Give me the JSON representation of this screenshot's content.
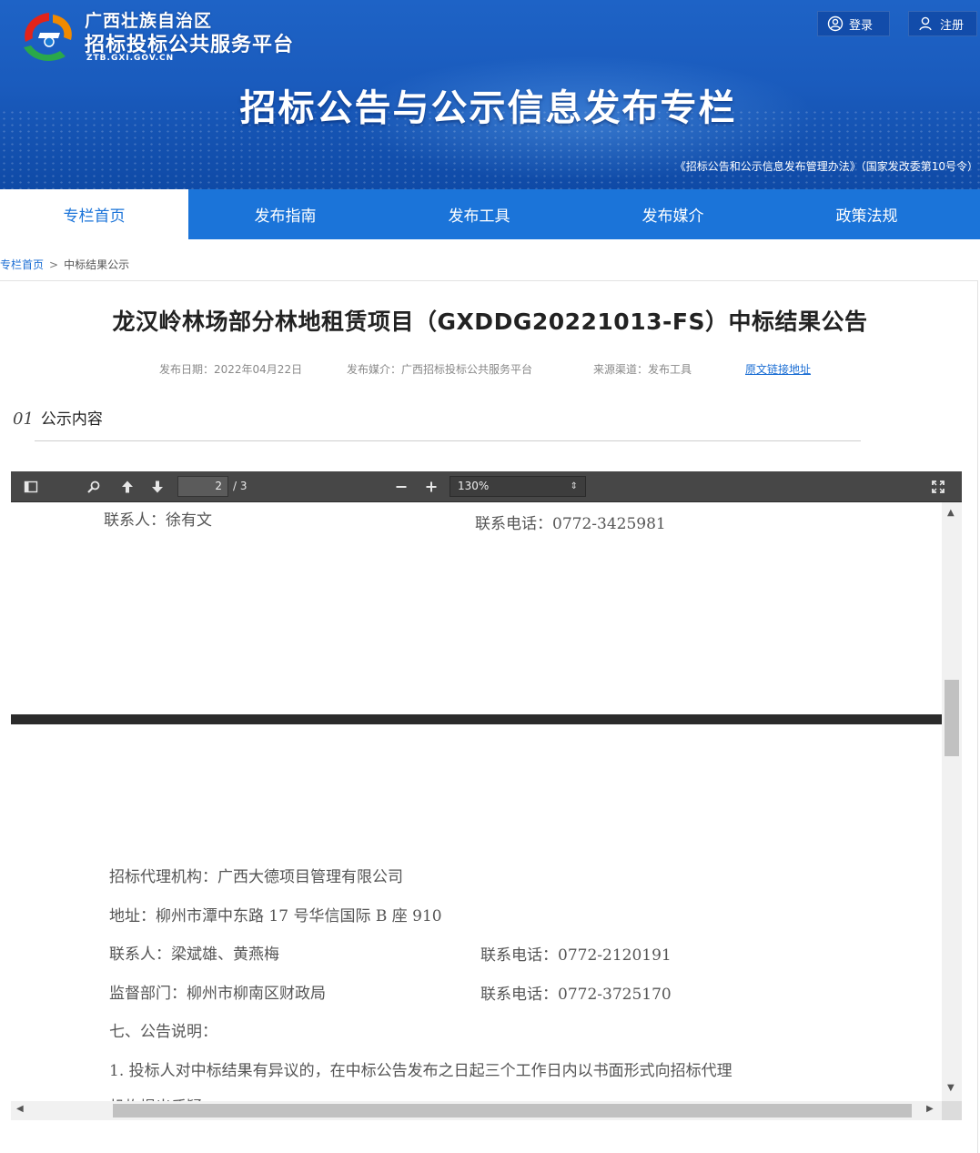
{
  "colors": {
    "brand_blue": "#1b74d9",
    "banner_blue": "#1a5bbd",
    "link_blue": "#1b6ed4",
    "toolbar_gray": "#474747"
  },
  "header": {
    "logo_line1": "广西壮族自治区",
    "logo_line2": "招标投标公共服务平台",
    "logo_domain": "ZTB.GXI.GOV.CN",
    "title": "招标公告与公示信息发布专栏",
    "subtitle": "《招标公告和公示信息发布管理办法》（国家发改委第10号令）",
    "login": "登录",
    "register": "注册"
  },
  "nav": {
    "items": [
      {
        "label": "专栏首页",
        "active": true
      },
      {
        "label": "发布指南",
        "active": false
      },
      {
        "label": "发布工具",
        "active": false
      },
      {
        "label": "发布媒介",
        "active": false
      },
      {
        "label": "政策法规",
        "active": false
      }
    ]
  },
  "breadcrumb": {
    "home": "专栏首页",
    "sep": ">",
    "current": "中标结果公示"
  },
  "article": {
    "title": "龙汉岭林场部分林地租赁项目（GXDDG20221013-FS）中标结果公告",
    "date": "发布日期：2022年04月22日",
    "media": "发布媒介：广西招标投标公共服务平台",
    "channel": "来源渠道：发布工具",
    "link": "原文链接地址",
    "section_num": "01",
    "section_label": "公示内容"
  },
  "pdf": {
    "page": "2",
    "total": "/ 3",
    "zoom": "130%",
    "zoom_arrow": "⇕",
    "lines": {
      "contact1": "联系人：徐有文",
      "phone1": "联系电话：0772-3425981",
      "agency": "招标代理机构：广西大德项目管理有限公司",
      "address": "地址：柳州市潭中东路 17 号华信国际 B 座 910",
      "contact2": "联系人：梁斌雄、黄燕梅",
      "phone2": "联系电话：0772-2120191",
      "supervisor": "监督部门：柳州市柳南区财政局",
      "phone3": "联系电话：0772-3725170",
      "notice_head": "七、公告说明：",
      "notice_1": "1. 投标人对中标结果有异议的，在中标公告发布之日起三个工作日内以书面形式向招标代理",
      "notice_1_cont": "机构提出质疑"
    }
  }
}
